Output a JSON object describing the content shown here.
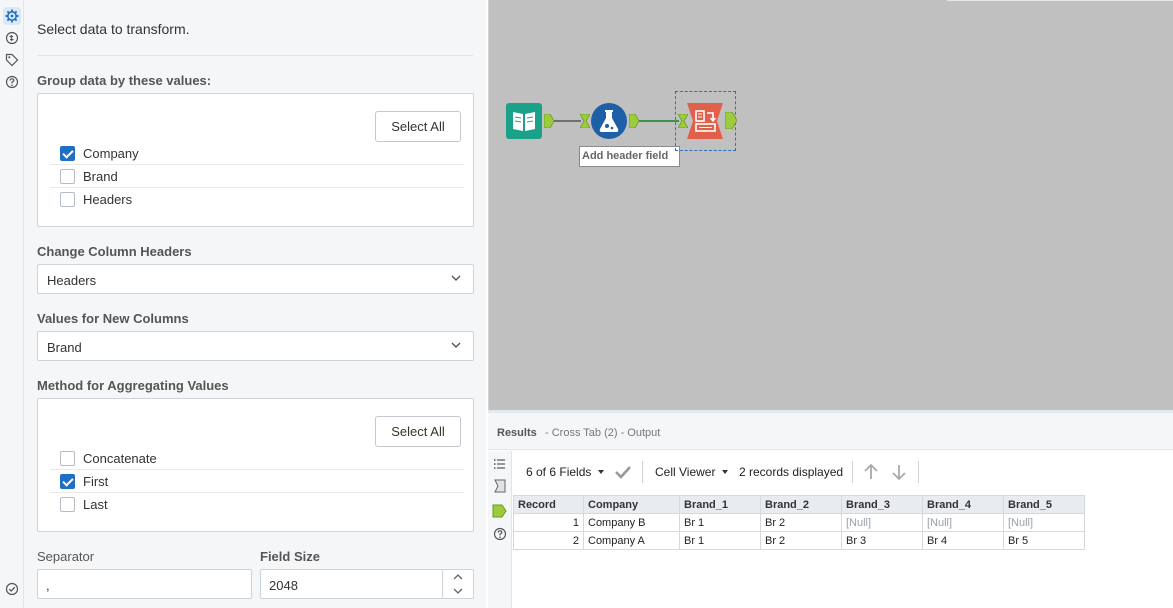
{
  "config": {
    "intro": "Select data to transform.",
    "group_label": "Group data by these values:",
    "group_select_all": "Select All",
    "group_fields": [
      {
        "label": "Company",
        "checked": true
      },
      {
        "label": "Brand",
        "checked": false
      },
      {
        "label": "Headers",
        "checked": false
      }
    ],
    "change_headers_label": "Change Column Headers",
    "change_headers_value": "Headers",
    "values_label": "Values for New Columns",
    "values_value": "Brand",
    "method_label": "Method for Aggregating Values",
    "method_select_all": "Select All",
    "methods": [
      {
        "label": "Concatenate",
        "checked": false
      },
      {
        "label": "First",
        "checked": true
      },
      {
        "label": "Last",
        "checked": false
      }
    ],
    "separator_label": "Separator",
    "separator_value": ",",
    "field_size_label": "Field Size",
    "field_size_value": "2048"
  },
  "canvas": {
    "tooltip": "Add header field"
  },
  "results": {
    "title": "Results",
    "subtitle": "- Cross Tab (2) - Output",
    "fields_count": "6 of 6 Fields",
    "viewer": "Cell Viewer",
    "records": "2 records displayed",
    "columns": [
      "Record",
      "Company",
      "Brand_1",
      "Brand_2",
      "Brand_3",
      "Brand_4",
      "Brand_5"
    ],
    "rows": [
      [
        "1",
        "Company B",
        "Br 1",
        "Br 2",
        "[Null]",
        "[Null]",
        "[Null]"
      ],
      [
        "2",
        "Company A",
        "Br 1",
        "Br 2",
        "Br 3",
        "Br 4",
        "Br 5"
      ]
    ]
  },
  "colors": {
    "accent": "#1f6fc5",
    "canvas_bg": "#c0c0c0",
    "input_tool": "#1ba08a",
    "formula_tool": "#1e5fa8",
    "crosstab_tool": "#e0604a",
    "anchor": "#9ccc3c"
  }
}
